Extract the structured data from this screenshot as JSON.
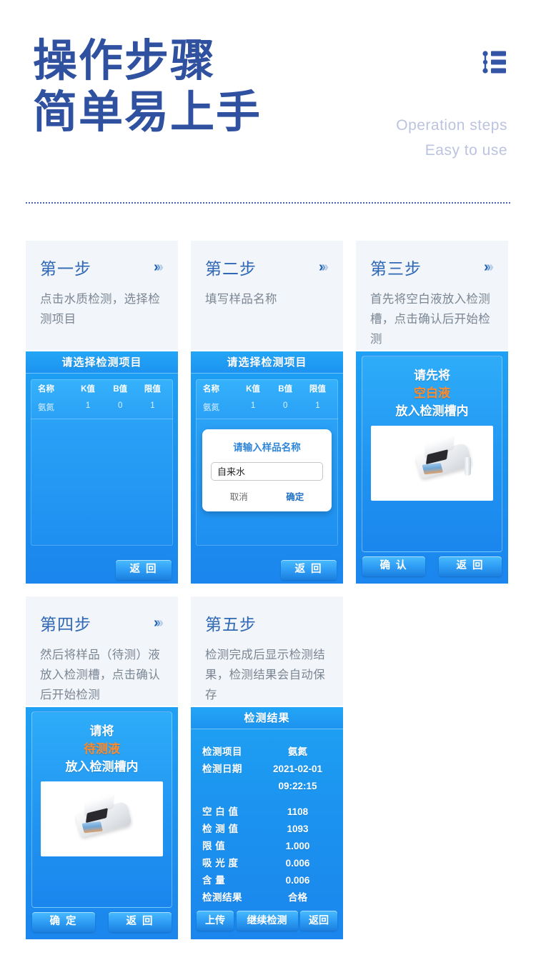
{
  "header": {
    "title_line1": "操作步骤",
    "title_line2": "简单易上手",
    "subtitle_en1": "Operation steps",
    "subtitle_en2": "Easy to use",
    "icon": "list-icon",
    "title_color": "#2f51a0",
    "subtitle_color": "#bcc3df",
    "divider_color": "#4a64b4"
  },
  "chevron": {
    "c1": "›",
    "c2": "›",
    "c3": "›"
  },
  "cards": [
    {
      "step": "第一步",
      "desc": "点击水质检测，选择检测项目",
      "has_chevron": true,
      "screen": {
        "type": "table",
        "title": "请选择检测项目",
        "columns": [
          "名称",
          "K值",
          "B值",
          "限值"
        ],
        "rows": [
          [
            "氨氮",
            "1",
            "0",
            "1"
          ]
        ],
        "back_button": "返 回"
      }
    },
    {
      "step": "第二步",
      "desc": "填写样品名称",
      "has_chevron": true,
      "screen": {
        "type": "table-dialog",
        "title": "请选择检测项目",
        "columns": [
          "名称",
          "K值",
          "B值",
          "限值"
        ],
        "rows": [
          [
            "氨氮",
            "1",
            "0",
            "1"
          ]
        ],
        "dialog": {
          "title": "请输入样品名称",
          "input_value": "自来水",
          "cancel": "取消",
          "confirm": "确定"
        },
        "back_button": "返 回"
      }
    },
    {
      "step": "第三步",
      "desc": "首先将空白液放入检测槽，点击确认后开始检测",
      "has_chevron": true,
      "screen": {
        "type": "prompt",
        "line1": "请先将",
        "line2": "空白液",
        "line3": "放入检测槽内",
        "accent_color": "#ff8a2a",
        "confirm_button": "确 认",
        "back_button": "返 回"
      }
    },
    {
      "step": "第四步",
      "desc": "然后将样品（待测）液放入检测槽，点击确认后开始检测",
      "has_chevron": true,
      "screen": {
        "type": "prompt",
        "line1": "请将",
        "line2": "待测液",
        "line3": "放入检测槽内",
        "accent_color": "#ff8a2a",
        "confirm_button": "确 定",
        "back_button": "返 回"
      }
    },
    {
      "step": "第五步",
      "desc": "检测完成后显示检测结果，检测结果会自动保存",
      "has_chevron": false,
      "screen": {
        "type": "result",
        "title": "检测结果",
        "fields": [
          {
            "key": "检测项目",
            "value": "氨氮"
          },
          {
            "key": "检测日期",
            "value": "2021-02-01"
          },
          {
            "key": "",
            "value": "09:22:15"
          }
        ],
        "measurements": [
          {
            "key": "空 白 值",
            "value": "1108"
          },
          {
            "key": "检 测 值",
            "value": "1093"
          },
          {
            "key": "限     值",
            "value": "1.000"
          },
          {
            "key": "吸 光 度",
            "value": "0.006"
          },
          {
            "key": "含     量",
            "value": "0.006"
          },
          {
            "key": "检测结果",
            "value": "合格"
          }
        ],
        "upload_button": "上传",
        "continue_button": "继续检测",
        "back_button": "返回"
      }
    }
  ]
}
